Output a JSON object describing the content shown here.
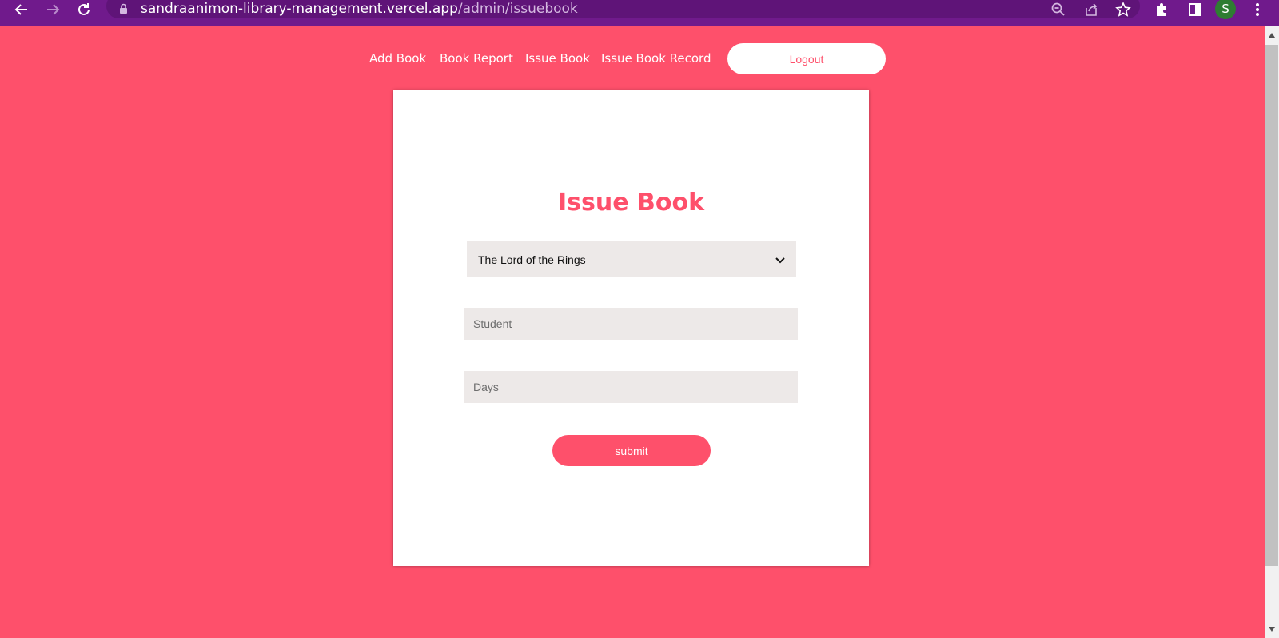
{
  "browser": {
    "url_host": "sandraanimon-library-management.vercel.app",
    "url_path": "/admin/issuebook",
    "profile_initial": "S",
    "toolbar_color": "#701a8c"
  },
  "nav": {
    "links": [
      "Add Book",
      "Book Report",
      "Issue Book",
      "Issue Book Record"
    ],
    "logout_label": "Logout"
  },
  "form": {
    "title": "Issue Book",
    "book_selected": "The Lord of the Rings",
    "student_placeholder": "Student",
    "days_placeholder": "Days",
    "submit_label": "submit"
  },
  "colors": {
    "page_background": "#fe506b",
    "accent": "#fe506b",
    "input_background": "#ede9e8"
  },
  "icons": [
    "back-arrow-icon",
    "forward-arrow-icon",
    "reload-icon",
    "lock-icon",
    "zoom-icon",
    "share-icon",
    "star-icon",
    "extensions-icon",
    "side-panel-icon",
    "more-menu-icon",
    "chevron-down-icon"
  ]
}
